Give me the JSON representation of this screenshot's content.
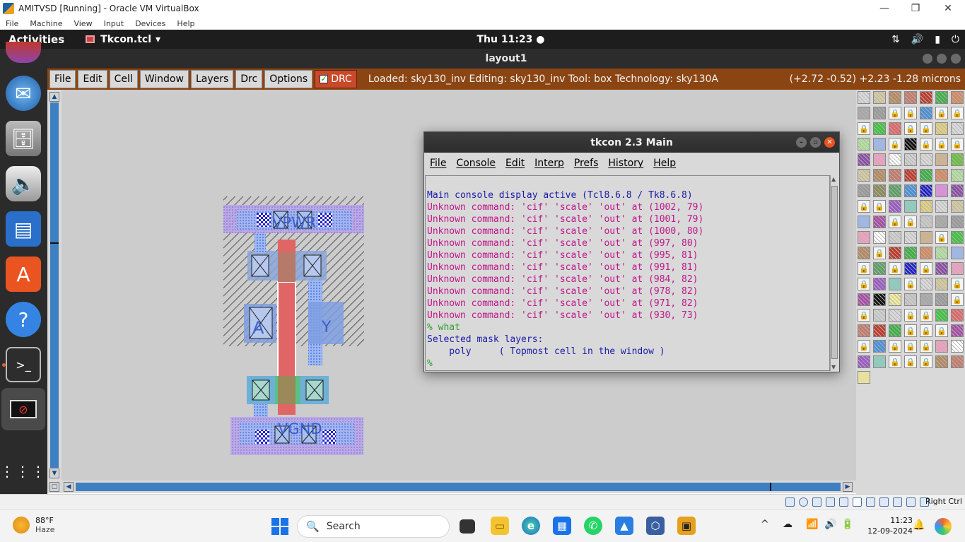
{
  "host_window": {
    "title": "AMITVSD [Running] - Oracle VM VirtualBox",
    "menu": [
      "File",
      "Machine",
      "View",
      "Input",
      "Devices",
      "Help"
    ],
    "controls": {
      "minimize": "—",
      "maximize": "❐",
      "close": "✕"
    }
  },
  "gnome": {
    "activities": "Activities",
    "app_name": "Tkcon.tcl",
    "app_arrow": "▾",
    "clock": "Thu 11:23 ●",
    "tray": [
      "network-icon",
      "volume-icon",
      "battery-icon",
      "power-icon"
    ]
  },
  "dock": {
    "items": [
      "firefox-icon",
      "thunderbird-icon",
      "files-icon",
      "rhythmbox-icon",
      "writer-icon",
      "software-icon",
      "help-icon",
      "terminal-icon",
      "app-icon",
      "show-apps-icon"
    ]
  },
  "layout_window": {
    "title": "layout1",
    "menu": [
      "File",
      "Edit",
      "Cell",
      "Window",
      "Layers",
      "Drc",
      "Options"
    ],
    "drc_label": "DRC",
    "drc_checked": "✓",
    "status": "Loaded: sky130_inv  Editing: sky130_inv  Tool: box  Technology: sky130A",
    "coords": "(+2.72 -0.52) +2.23 -1.28 microns",
    "labels": {
      "vpwr": "VPWR",
      "vgnd": "VGND",
      "input": "A",
      "output": "Y"
    },
    "colors": {
      "bar": "#8b4513",
      "canvas": "#cccccc",
      "poly": "#e06666",
      "diff": "#3a6fd8"
    }
  },
  "tkcon": {
    "title": "tkcon 2.3 Main",
    "menu": [
      "File",
      "Console",
      "Edit",
      "Interp",
      "Prefs",
      "History",
      "Help"
    ],
    "lines": [
      {
        "text": "Main console display active (Tcl8.6.8 / Tk8.6.8)",
        "color": "#1a1aa8"
      },
      {
        "text": "Unknown command: 'cif' 'scale' 'out' at (1002, 79)",
        "color": "#c0168a"
      },
      {
        "text": "Unknown command: 'cif' 'scale' 'out' at (1001, 79)",
        "color": "#c0168a"
      },
      {
        "text": "Unknown command: 'cif' 'scale' 'out' at (1000, 80)",
        "color": "#c0168a"
      },
      {
        "text": "Unknown command: 'cif' 'scale' 'out' at (997, 80)",
        "color": "#c0168a"
      },
      {
        "text": "Unknown command: 'cif' 'scale' 'out' at (995, 81)",
        "color": "#c0168a"
      },
      {
        "text": "Unknown command: 'cif' 'scale' 'out' at (991, 81)",
        "color": "#c0168a"
      },
      {
        "text": "Unknown command: 'cif' 'scale' 'out' at (984, 82)",
        "color": "#c0168a"
      },
      {
        "text": "Unknown command: 'cif' 'scale' 'out' at (978, 82)",
        "color": "#c0168a"
      },
      {
        "text": "Unknown command: 'cif' 'scale' 'out' at (971, 82)",
        "color": "#c0168a"
      },
      {
        "text": "Unknown command: 'cif' 'scale' 'out' at (930, 73)",
        "color": "#c0168a"
      },
      {
        "text": "% what",
        "color": "#2e9e2e"
      },
      {
        "text": "Selected mask layers:",
        "color": "#1a1aa8"
      },
      {
        "text": "    poly     ( Topmost cell in the window )",
        "color": "#1a1aa8"
      },
      {
        "text": "%",
        "color": "#2e9e2e"
      }
    ]
  },
  "vbox_status": {
    "host_key": "Right Ctrl"
  },
  "taskbar": {
    "weather_temp": "88°F",
    "weather_desc": "Haze",
    "search_placeholder": "Search",
    "time": "11:23",
    "date": "12-09-2024",
    "chevron": "^"
  }
}
